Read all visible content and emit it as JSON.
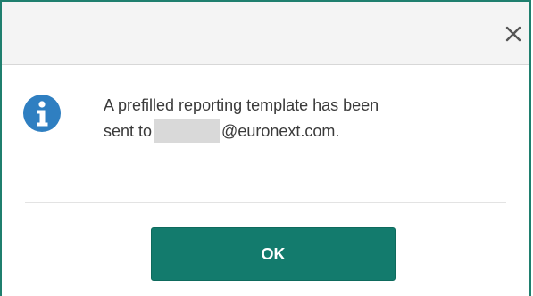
{
  "dialog": {
    "close_icon": "close-icon",
    "info_icon": "info-icon",
    "message_line1": "A prefilled reporting template has been",
    "message_line2_prefix": "sent to",
    "message_line2_suffix": "@euronext.com.",
    "ok_label": "OK"
  },
  "colors": {
    "accent": "#137b6d",
    "info_icon": "#2f7fc1",
    "border": "#1f7f6e"
  }
}
